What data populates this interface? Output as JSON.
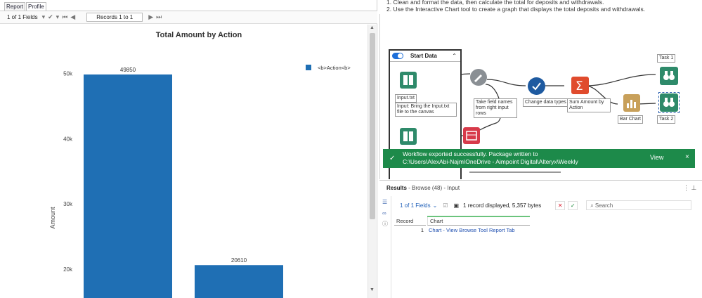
{
  "left_pane": {
    "tabs": [
      "Report",
      "Profile"
    ],
    "toolbar": {
      "fields_label": "1 of 1 Fields",
      "records_label": "Records 1 to 1"
    }
  },
  "chart_data": {
    "type": "bar",
    "title": "Total Amount by Action",
    "categories": [
      "",
      ""
    ],
    "values": [
      49850,
      20610
    ],
    "data_labels": [
      "49850",
      "20610"
    ],
    "ylabel": "Amount",
    "y_ticks": [
      20000,
      30000,
      40000,
      50000
    ],
    "y_tick_labels": [
      "20k",
      "30k",
      "40k",
      "50k"
    ],
    "ylim": [
      16000,
      57500
    ],
    "legend": {
      "entries": [
        "<b>Action<b>"
      ],
      "placement": "top-right"
    },
    "colors": [
      "#1f6fb4"
    ],
    "grid": false
  },
  "instructions": {
    "line1": "1. Clean and format the data, then calculate the total for deposits and withdrawals.",
    "line2": "2. Use the Interactive Chart tool to create a graph that displays the total deposits and withdrawals."
  },
  "workflow": {
    "container_title": "Start Data",
    "tools": {
      "input_label": "Input.txt",
      "input_annotation": "Input: Bring the Input.txt file to the canvas",
      "dynamic_rename_label": "Take field names from right input rows",
      "select_label": "Change data types",
      "summarize_label": "Sum Amount by Action",
      "chart_label": "Bar Chart",
      "browse1_label": "Task 1",
      "browse2_label": "Task 2"
    },
    "colors": {
      "input": "#2e8a6a",
      "dynamic": "#8a8f94",
      "select": "#1e5aa0",
      "summarize": "#e04b2d",
      "report": "#c8a05a",
      "browse": "#2e8a6a",
      "rename": "#d73a4a"
    }
  },
  "toast": {
    "message_line1": "Workflow exported successfully. Package written to",
    "message_line2": "C:\\Users\\AlexAbi-Najm\\OneDrive - Aimpoint Digital\\Alteryx\\Weekly",
    "view_label": "View",
    "close_label": "×"
  },
  "results": {
    "title": "Results",
    "subtitle": " - Browse (48) - Input",
    "fields_label": "1 of 1 Fields",
    "records_text": "1 record displayed, 5,357 bytes",
    "search_placeholder": "Search",
    "columns": [
      "Record",
      "Chart"
    ],
    "row": {
      "record": "1",
      "chart": "Chart - View Browse Tool Report Tab"
    }
  }
}
